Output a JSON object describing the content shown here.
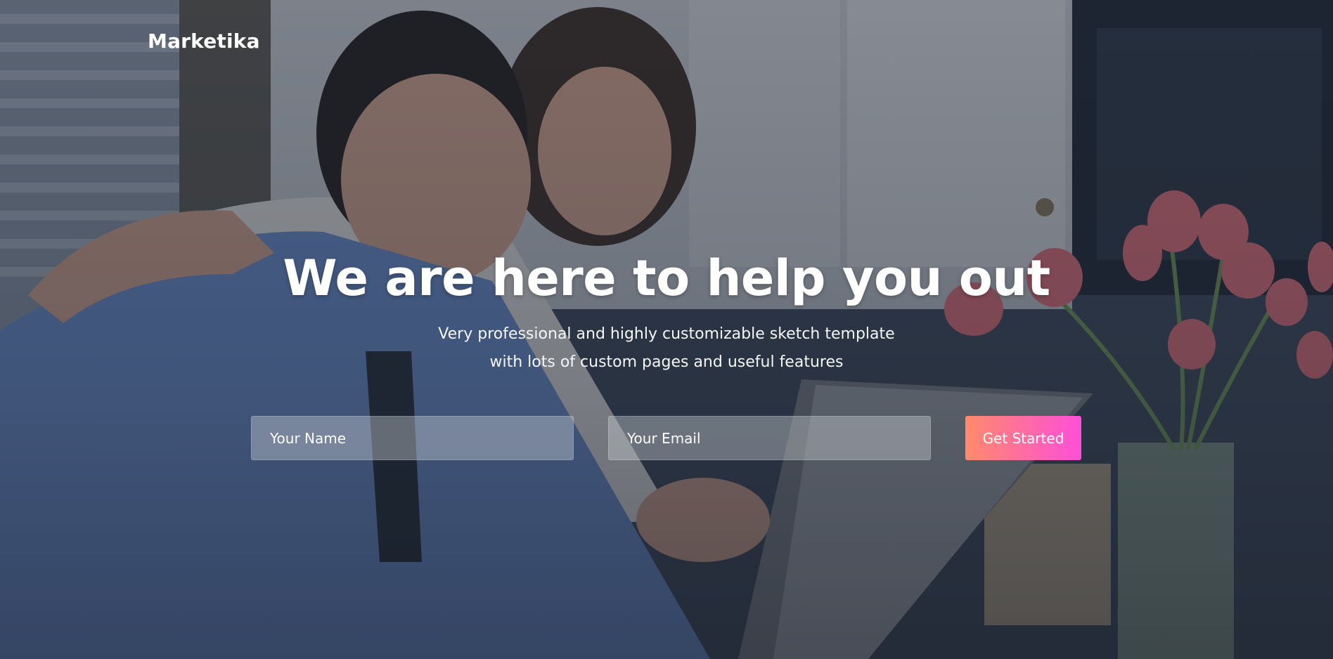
{
  "brand": {
    "name": "Marketika"
  },
  "hero": {
    "headline": "We are here to help you out",
    "subline_1": "Very professional and highly customizable sketch template",
    "subline_2": "with lots of custom pages and useful features"
  },
  "form": {
    "name_placeholder": "Your Name",
    "email_placeholder": "Your Email",
    "submit_label": "Get Started"
  },
  "colors": {
    "cta_gradient_start": "#ff8a6b",
    "cta_gradient_end": "#ff4fd8",
    "text": "#ffffff"
  }
}
